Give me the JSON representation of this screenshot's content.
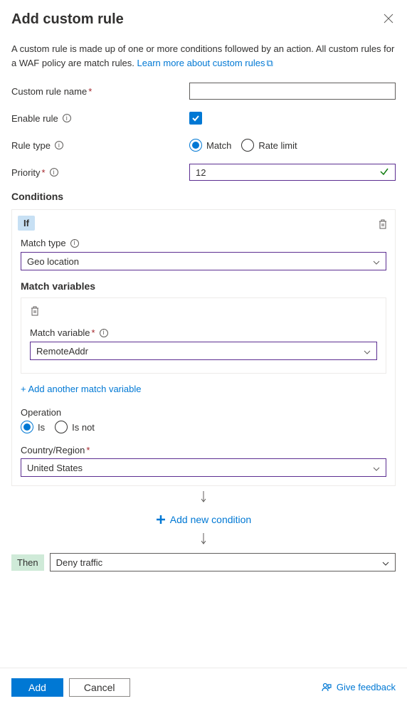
{
  "header": {
    "title": "Add custom rule"
  },
  "intro": {
    "text": "A custom rule is made up of one or more conditions followed by an action. All custom rules for a WAF policy are match rules. ",
    "link": "Learn more about custom rules"
  },
  "form": {
    "custom_name_label": "Custom rule name",
    "custom_name_value": "",
    "enable_label": "Enable rule",
    "enable_checked": "true",
    "rule_type_label": "Rule type",
    "rule_type_match": "Match",
    "rule_type_rate": "Rate limit",
    "priority_label": "Priority",
    "priority_value": "12"
  },
  "conditions": {
    "title": "Conditions",
    "if": "If",
    "match_type_label": "Match type",
    "match_type_value": "Geo location",
    "match_vars_title": "Match variables",
    "match_var_label": "Match variable",
    "match_var_value": "RemoteAddr",
    "add_var": "+ Add another match variable",
    "operation_label": "Operation",
    "op_is": "Is",
    "op_isnot": "Is not",
    "country_label": "Country/Region",
    "country_value": "United States",
    "add_condition": "Add new condition",
    "then": "Then",
    "then_value": "Deny traffic"
  },
  "footer": {
    "add": "Add",
    "cancel": "Cancel",
    "feedback": "Give feedback"
  }
}
